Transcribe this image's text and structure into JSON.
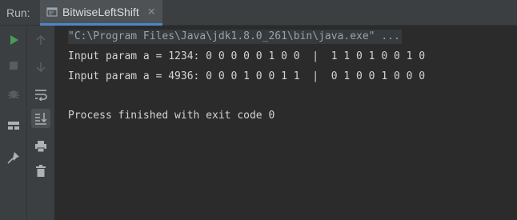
{
  "run_panel": {
    "label": "Run:",
    "tab": {
      "title": "BitwiseLeftShift",
      "close_glyph": "✕",
      "icon": "console-window-icon"
    }
  },
  "toolbar": {
    "left_column": [
      "rerun-icon",
      "stop-icon",
      "debug-bug-icon",
      "layout-icon",
      "pin-icon"
    ],
    "right_column": [
      "up-arrow-icon",
      "down-arrow-icon",
      "soft-wrap-icon",
      "scroll-to-end-icon",
      "print-icon",
      "trash-icon"
    ]
  },
  "console": {
    "lines": [
      "\"C:\\Program Files\\Java\\jdk1.8.0_261\\bin\\java.exe\" ...",
      "Input param a = 1234: 0 0 0 0 0 1 0 0  |  1 1 0 1 0 0 1 0",
      "Input param a = 4936: 0 0 0 1 0 0 1 1  |  0 1 0 0 1 0 0 0",
      "",
      "Process finished with exit code 0"
    ]
  },
  "colors": {
    "background": "#2b2b2b",
    "panel": "#3c3f41",
    "run_green": "#499c54",
    "accent_blue": "#4a88c7",
    "text": "#d4d4d4"
  }
}
